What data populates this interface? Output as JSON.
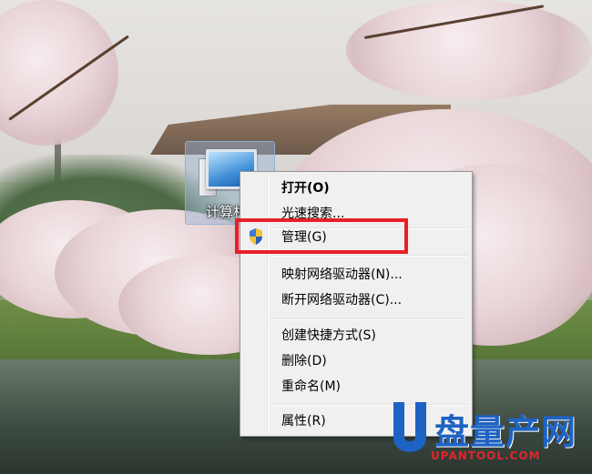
{
  "desktop": {
    "icon_label": "计算机"
  },
  "context_menu": {
    "items": [
      {
        "label": "打开(O)",
        "bold": true
      },
      {
        "label": "光速搜索..."
      },
      {
        "label": "管理(G)",
        "icon": "uac-shield-icon",
        "highlighted": true
      },
      {
        "label": "映射网络驱动器(N)..."
      },
      {
        "label": "断开网络驱动器(C)..."
      },
      {
        "label": "创建快捷方式(S)"
      },
      {
        "label": "删除(D)"
      },
      {
        "label": "重命名(M)"
      },
      {
        "label": "属性(R)"
      }
    ]
  },
  "annotation": {
    "highlight_color": "#e81f2a"
  },
  "watermark": {
    "brand": "盘量产网",
    "url": "UPANTOOL.COM"
  }
}
